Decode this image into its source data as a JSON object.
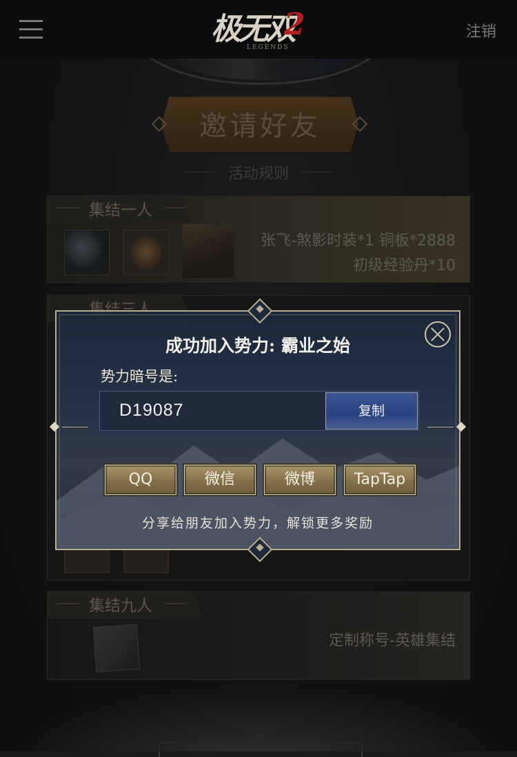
{
  "header": {
    "logo_text": "极无双",
    "logo_number": "2",
    "logo_sub": "LEGENDS",
    "logout_label": "注销"
  },
  "page": {
    "title": "邀请好友",
    "rules_label": "活动规则"
  },
  "cards": [
    {
      "tab_label": "集结一人",
      "rewards_line1": "张飞-煞影时装*1  铜板*2888",
      "rewards_line2": "初级经验丹*10",
      "icons": [
        "orb-icon",
        "copper-coin-icon",
        "zhangfei-portrait-icon"
      ]
    },
    {
      "tab_label": "集结三人"
    },
    {
      "tab_label": "集结九人",
      "rewards_line1": "定制称号-英雄集结",
      "icons": [
        "title-book-icon"
      ]
    }
  ],
  "dialog": {
    "title": "成功加入势力: 霸业之始",
    "code_label": "势力暗号是:",
    "code_value": "D19087",
    "copy_label": "复制",
    "share_buttons": [
      "QQ",
      "微信",
      "微博",
      "TapTap"
    ],
    "share_hint": "分享给朋友加入势力，解锁更多奖励"
  },
  "colors": {
    "dialog_border": "#b9ae93",
    "copy_button": "#2a4282",
    "share_button": "#87744e",
    "header_bg": "#0d0d0e"
  }
}
